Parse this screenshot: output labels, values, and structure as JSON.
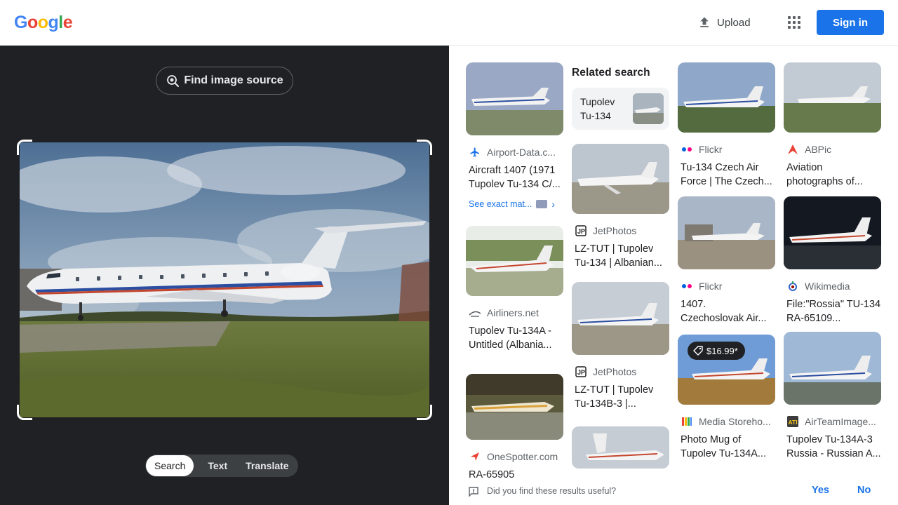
{
  "header": {
    "logo_letters": [
      {
        "ch": "G",
        "color": "#4285f4"
      },
      {
        "ch": "o",
        "color": "#ea4335"
      },
      {
        "ch": "o",
        "color": "#fbbc05"
      },
      {
        "ch": "g",
        "color": "#4285f4"
      },
      {
        "ch": "l",
        "color": "#34a853"
      },
      {
        "ch": "e",
        "color": "#ea4335"
      }
    ],
    "upload_label": "Upload",
    "signin_label": "Sign in",
    "upload_icon": "upload-icon",
    "apps_icon": "apps-grid-icon"
  },
  "left": {
    "find_source_label": "Find image source",
    "modes": [
      "Search",
      "Text",
      "Translate"
    ],
    "active_mode": "Search"
  },
  "related": {
    "heading": "Related search",
    "chip_line1": "Tupolev",
    "chip_line2": "Tu-134"
  },
  "results": {
    "col1": [
      {
        "source": "Airport-Data.c...",
        "line1": "Aircraft 1407 (1971",
        "line2": "Tupolev Tu-134 C/...",
        "exact": "See exact mat..."
      },
      {
        "source": "Airliners.net",
        "line1": "Tupolev Tu-134A -",
        "line2": "Untitled (Albania..."
      },
      {
        "source": "OneSpotter.com",
        "line1": "RA-65905",
        "line2": ""
      }
    ],
    "col2": [
      {
        "source": "JetPhotos",
        "line1": "LZ-TUT | Tupolev",
        "line2": "Tu-134 | Albanian..."
      },
      {
        "source": "JetPhotos",
        "line1": "LZ-TUT | Tupolev",
        "line2": "Tu-134B-3 |..."
      }
    ],
    "col3": [
      {
        "source": "Flickr",
        "line1": "Tu-134 Czech Air",
        "line2": "Force | The Czech..."
      },
      {
        "source": "Flickr",
        "line1": "1407.",
        "line2": "Czechoslovak Air..."
      },
      {
        "source": "Media Storeho...",
        "line1": "Photo Mug of",
        "line2": "Tupolev Tu-134A...",
        "price": "$16.99*"
      }
    ],
    "col4": [
      {
        "source": "ABPic",
        "line1": "Aviation",
        "line2": "photographs of..."
      },
      {
        "source": "Wikimedia",
        "line1": "File:\"Rossia\" TU-134",
        "line2": "RA-65109..."
      },
      {
        "source": "AirTeamImage...",
        "line1": "Tupolev Tu-134A-3",
        "line2": "Russia - Russian A..."
      }
    ]
  },
  "feedback": {
    "question": "Did you find these results useful?",
    "yes": "Yes",
    "no": "No"
  }
}
